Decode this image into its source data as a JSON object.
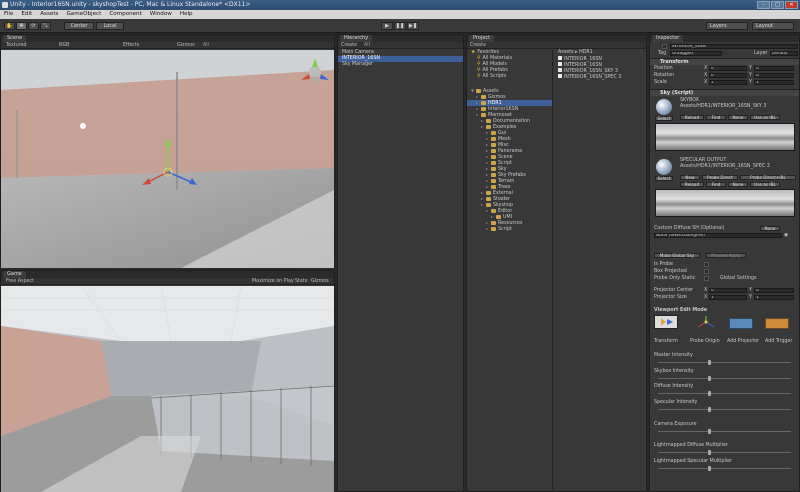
{
  "window": {
    "title": "Unity - Interior16SN.unity - skyshopTest - PC, Mac & Linux Standalone* <DX11>"
  },
  "menu": [
    "File",
    "Edit",
    "Assets",
    "GameObject",
    "Component",
    "Window",
    "Help"
  ],
  "toolbar": {
    "pivot": "Center",
    "space": "Local",
    "play": "▶",
    "pause": "❚❚",
    "step": "▶❚",
    "layers": "Layers",
    "layout": "Layout"
  },
  "scene": {
    "tab": "Scene",
    "shading": "Textured",
    "render": "RGB",
    "effects": "Effects",
    "gizmos": "Gizmos",
    "search": "All"
  },
  "game": {
    "tab": "Game",
    "aspect": "Free Aspect",
    "maximize": "Maximize on Play",
    "stats": "Stats",
    "gizmos": "Gizmos"
  },
  "hierarchy": {
    "tab": "Hierarchy",
    "create": "Create",
    "search": "All",
    "items": [
      "Main Camera",
      "INTERIOR_16SN",
      "Sky Manager"
    ]
  },
  "project": {
    "tab": "Project",
    "create": "Create",
    "favorites_label": "Favorites",
    "favorites": [
      "All Materials",
      "All Models",
      "All Prefabs",
      "All Scripts"
    ],
    "assets_label": "Assets",
    "tree": [
      {
        "label": "Gizmos",
        "d": 1
      },
      {
        "label": "HDR1",
        "d": 1,
        "sel": true
      },
      {
        "label": "Interior16SN",
        "d": 1
      },
      {
        "label": "Marmoset",
        "d": 1
      },
      {
        "label": "Documentation",
        "d": 2
      },
      {
        "label": "Examples",
        "d": 2
      },
      {
        "label": "Gui",
        "d": 3
      },
      {
        "label": "Mesh",
        "d": 3
      },
      {
        "label": "Misc",
        "d": 3
      },
      {
        "label": "Panorama",
        "d": 3
      },
      {
        "label": "Scene",
        "d": 3
      },
      {
        "label": "Script",
        "d": 3
      },
      {
        "label": "Sky",
        "d": 3
      },
      {
        "label": "Sky Prefabs",
        "d": 3
      },
      {
        "label": "Terrain",
        "d": 3
      },
      {
        "label": "Trees",
        "d": 3
      },
      {
        "label": "External",
        "d": 2
      },
      {
        "label": "Shader",
        "d": 2
      },
      {
        "label": "Skyshop",
        "d": 2
      },
      {
        "label": "Editor",
        "d": 3
      },
      {
        "label": "UMI",
        "d": 4
      },
      {
        "label": "Resources",
        "d": 3
      },
      {
        "label": "Script",
        "d": 3
      }
    ],
    "breadcrumb": [
      "Assets",
      "HDR1"
    ],
    "files": [
      "INTERIOR_16SN",
      "INTERIOR_16SN",
      "INTERIOR_16SN_SKY 3",
      "INTERIOR_16SN_SPEC 3"
    ]
  },
  "inspector": {
    "tab": "Inspector",
    "object_name": "INTERIOR_16SN",
    "tag_label": "Tag",
    "tag_value": "Untagged",
    "layer_label": "Layer",
    "layer_value": "Default",
    "transform": {
      "title": "Transform",
      "rows": [
        {
          "label": "Position",
          "x": "0",
          "y": "0"
        },
        {
          "label": "Rotation",
          "x": "0",
          "y": "0"
        },
        {
          "label": "Scale",
          "x": "1",
          "y": "1"
        }
      ]
    },
    "sky": {
      "title": "Sky (Script)",
      "skybox_label": "SKYBOX",
      "skybox_asset": "Assets/HDR1/INTERIOR_16SN_SKY 3",
      "btn_select": "Select",
      "btn_reload": "Reload",
      "btn_find": "Find",
      "btn_none": "None",
      "btn_use": "Use as IBL",
      "spec_label": "SPECULAR OUTPUT",
      "spec_asset": "Assets/HDR1/INTERIOR_16SN_SPEC 3",
      "btn_new": "New",
      "btn_probe_direct": "Probe Direct",
      "btn_probe_ibl": "Probe Direct+IBL",
      "custom_diffuse": "Custom Diffuse SH (Optional)",
      "custom_none_btn": "None",
      "custom_value": "None (SHEncodingFile)",
      "btn_global": "Make Global Sky",
      "btn_preview": "Preview Apply",
      "is_probe": "Is Probe",
      "box_projected": "Box Projected",
      "probe_only_static": "Probe Only Static",
      "global_settings": "Global Settings",
      "projector_center": "Projector Center",
      "projector_size": "Projector Size",
      "pc_x": "0",
      "pc_y": "0",
      "ps_x": "1",
      "ps_y": "1",
      "viewport_mode": "Viewport Edit Mode",
      "modes": [
        "Transform",
        "Probe Origin",
        "Add Projector",
        "Add Trigger"
      ],
      "intensities": [
        "Master Intensity",
        "Skybox Intensity",
        "Diffuse Intensity",
        "Specular Intensity",
        "Camera Exposure",
        "Lightmapped Diffuse Multiplier",
        "Lightmapped Specular Multiplier"
      ]
    }
  }
}
